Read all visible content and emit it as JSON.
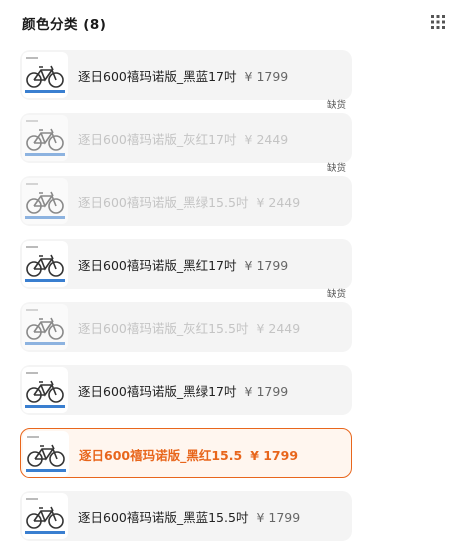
{
  "header": {
    "title": "颜色分类 (8)"
  },
  "options": [
    {
      "name": "逐日600禧玛诺版_黑蓝17吋",
      "price": "¥ 1799",
      "stock_tag": "",
      "state": "normal"
    },
    {
      "name": "逐日600禧玛诺版_灰红17吋",
      "price": "¥ 2449",
      "stock_tag": "缺货",
      "state": "disabled"
    },
    {
      "name": "逐日600禧玛诺版_黑绿15.5吋",
      "price": "¥ 2449",
      "stock_tag": "缺货",
      "state": "disabled"
    },
    {
      "name": "逐日600禧玛诺版_黑红17吋",
      "price": "¥ 1799",
      "stock_tag": "",
      "state": "normal"
    },
    {
      "name": "逐日600禧玛诺版_灰红15.5吋",
      "price": "¥ 2449",
      "stock_tag": "缺货",
      "state": "disabled"
    },
    {
      "name": "逐日600禧玛诺版_黑绿17吋",
      "price": "¥ 1799",
      "stock_tag": "",
      "state": "normal"
    },
    {
      "name": "逐日600禧玛诺版_黑红15.5",
      "price": "¥ 1799",
      "stock_tag": "",
      "state": "selected"
    },
    {
      "name": "逐日600禧玛诺版_黑蓝15.5吋",
      "price": "¥ 1799",
      "stock_tag": "",
      "state": "normal"
    }
  ],
  "icons": {
    "grid": "grid-icon",
    "thumbnail": "bicycle-icon"
  },
  "colors": {
    "accent": "#e8661c",
    "option_bg": "#f4f4f4",
    "disabled_text": "#c4c4c4",
    "bike_stripe": "#3a7fd0"
  }
}
